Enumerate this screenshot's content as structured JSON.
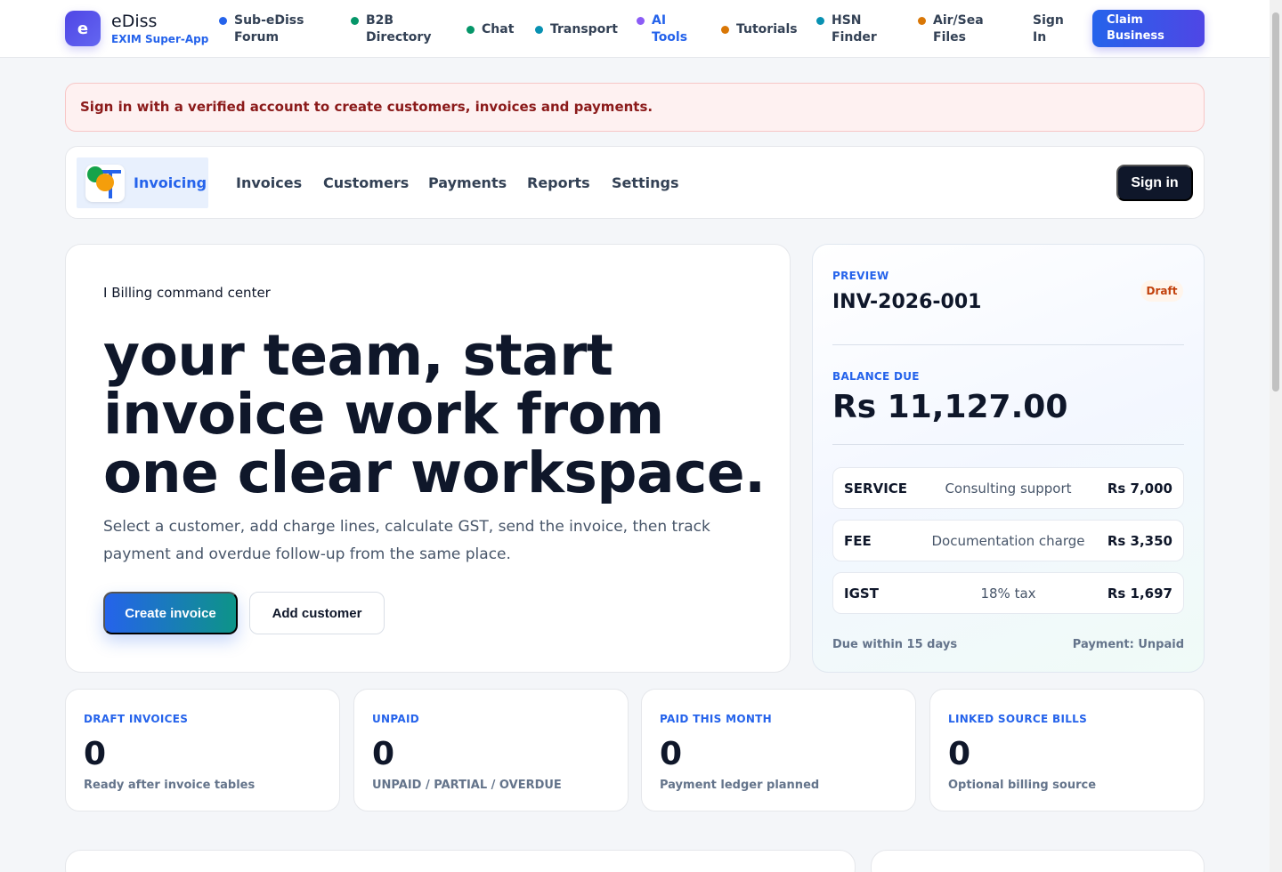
{
  "topnav": {
    "brand_initial": "e",
    "brand_name": "eDiss",
    "brand_sub": "EXIM Super-App",
    "links": [
      {
        "label_line1": "Sub-eDiss",
        "label_line2": "Forum",
        "color": "#2563eb"
      },
      {
        "label_line1": "B2B",
        "label_line2": "Directory",
        "color": "#059669"
      },
      {
        "label_line1": "Chat",
        "label_line2": "",
        "color": "#059669"
      },
      {
        "label_line1": "Transport",
        "label_line2": "",
        "color": "#0891b2"
      },
      {
        "label_line1": "AI",
        "label_line2": "Tools",
        "color": "#8b5cf6"
      },
      {
        "label_line1": "Tutorials",
        "label_line2": "",
        "color": "#d97706"
      },
      {
        "label_line1": "HSN",
        "label_line2": "Finder",
        "color": "#0891b2"
      },
      {
        "label_line1": "Air/Sea",
        "label_line2": "Files",
        "color": "#d97706"
      }
    ],
    "signin_line1": "Sign",
    "signin_line2": "In",
    "claim_line1": "Claim",
    "claim_line2": "Business"
  },
  "alert": {
    "text": "Sign in with a verified account to create customers, invoices and payments."
  },
  "subnav": {
    "active_label": "Invoicing",
    "items": [
      "Invoices",
      "Customers",
      "Payments",
      "Reports",
      "Settings"
    ],
    "signin_label": "Sign in"
  },
  "hero": {
    "eyebrow": "I Billing command center",
    "headline": "your team, start invoice work from one clear workspace.",
    "lead": "Select a customer, add charge lines, calculate GST, send the invoice, then track payment and overdue follow-up from the same place.",
    "primary_button": "Create invoice",
    "secondary_button": "Add customer"
  },
  "preview": {
    "eyebrow": "PREVIEW",
    "invoice_number": "INV-2026-001",
    "status_badge": "Draft",
    "balance_label": "BALANCE DUE",
    "balance_value": "Rs 11,127.00",
    "line_items": [
      {
        "code": "SERVICE",
        "description": "Consulting support",
        "amount": "Rs 7,000"
      },
      {
        "code": "FEE",
        "description": "Documentation charge",
        "amount": "Rs 3,350"
      },
      {
        "code": "IGST",
        "description": "18% tax",
        "amount": "Rs 1,697"
      }
    ],
    "footer_left": "Due within 15 days",
    "footer_right": "Payment: Unpaid"
  },
  "stats": [
    {
      "label": "DRAFT INVOICES",
      "value": "0",
      "sub": "Ready after invoice tables"
    },
    {
      "label": "UNPAID",
      "value": "0",
      "sub": "UNPAID / PARTIAL / OVERDUE"
    },
    {
      "label": "PAID THIS MONTH",
      "value": "0",
      "sub": "Payment ledger planned"
    },
    {
      "label": "LINKED SOURCE BILLS",
      "value": "0",
      "sub": "Optional billing source"
    }
  ]
}
